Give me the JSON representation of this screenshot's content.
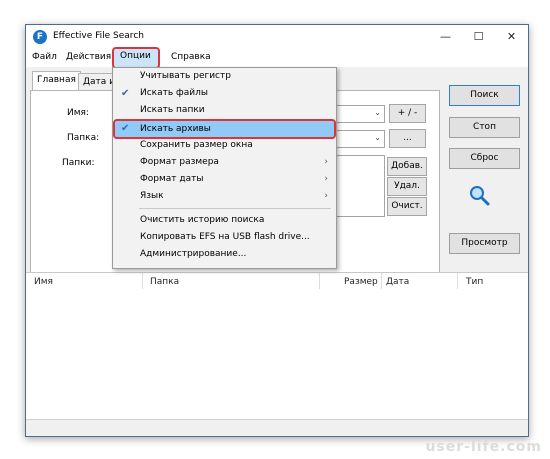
{
  "window": {
    "title": "Effective File Search",
    "minimize": "—",
    "maximize": "☐",
    "close": "✕"
  },
  "menubar": {
    "file": "Файл",
    "actions": "Действия",
    "options": "Опции",
    "help": "Справка"
  },
  "tabs": {
    "main": "Главная",
    "date": "Дата и"
  },
  "form": {
    "name_label": "Имя:",
    "folder_label": "Папка:",
    "folders_label": "Папки:"
  },
  "buttons": {
    "plus_minus": "+ / -",
    "browse": "...",
    "add": "Добав.",
    "remove": "Удал.",
    "clear": "Очист."
  },
  "actions": {
    "search": "Поиск",
    "stop": "Стоп",
    "reset": "Сброс",
    "view": "Просмотр"
  },
  "results": {
    "columns": [
      "Имя",
      "Папка",
      "Размер",
      "Дата",
      "Тип"
    ]
  },
  "options_menu": {
    "items": [
      {
        "label": "Учитывать регистр",
        "checked": false,
        "submenu": false
      },
      {
        "label": "Искать файлы",
        "checked": true,
        "submenu": false
      },
      {
        "label": "Искать папки",
        "checked": false,
        "submenu": false
      },
      {
        "label": "Искать архивы",
        "checked": true,
        "submenu": false
      },
      {
        "label": "Сохранить размер окна",
        "checked": false,
        "submenu": false
      },
      {
        "label": "Формат размера",
        "checked": false,
        "submenu": true
      },
      {
        "label": "Формат даты",
        "checked": false,
        "submenu": true
      },
      {
        "label": "Язык",
        "checked": false,
        "submenu": true
      },
      {
        "label": "Очистить историю поиска",
        "checked": false,
        "submenu": false
      },
      {
        "label": "Копировать EFS на USB flash drive...",
        "checked": false,
        "submenu": false
      },
      {
        "label": "Администрирование...",
        "checked": false,
        "submenu": false
      }
    ],
    "check_glyph": "✔",
    "submenu_glyph": "›"
  },
  "watermark": "user-life.com",
  "colors": {
    "highlight_border": "#d9353a",
    "selection": "#91c9f7",
    "accent": "#1a73c9"
  }
}
